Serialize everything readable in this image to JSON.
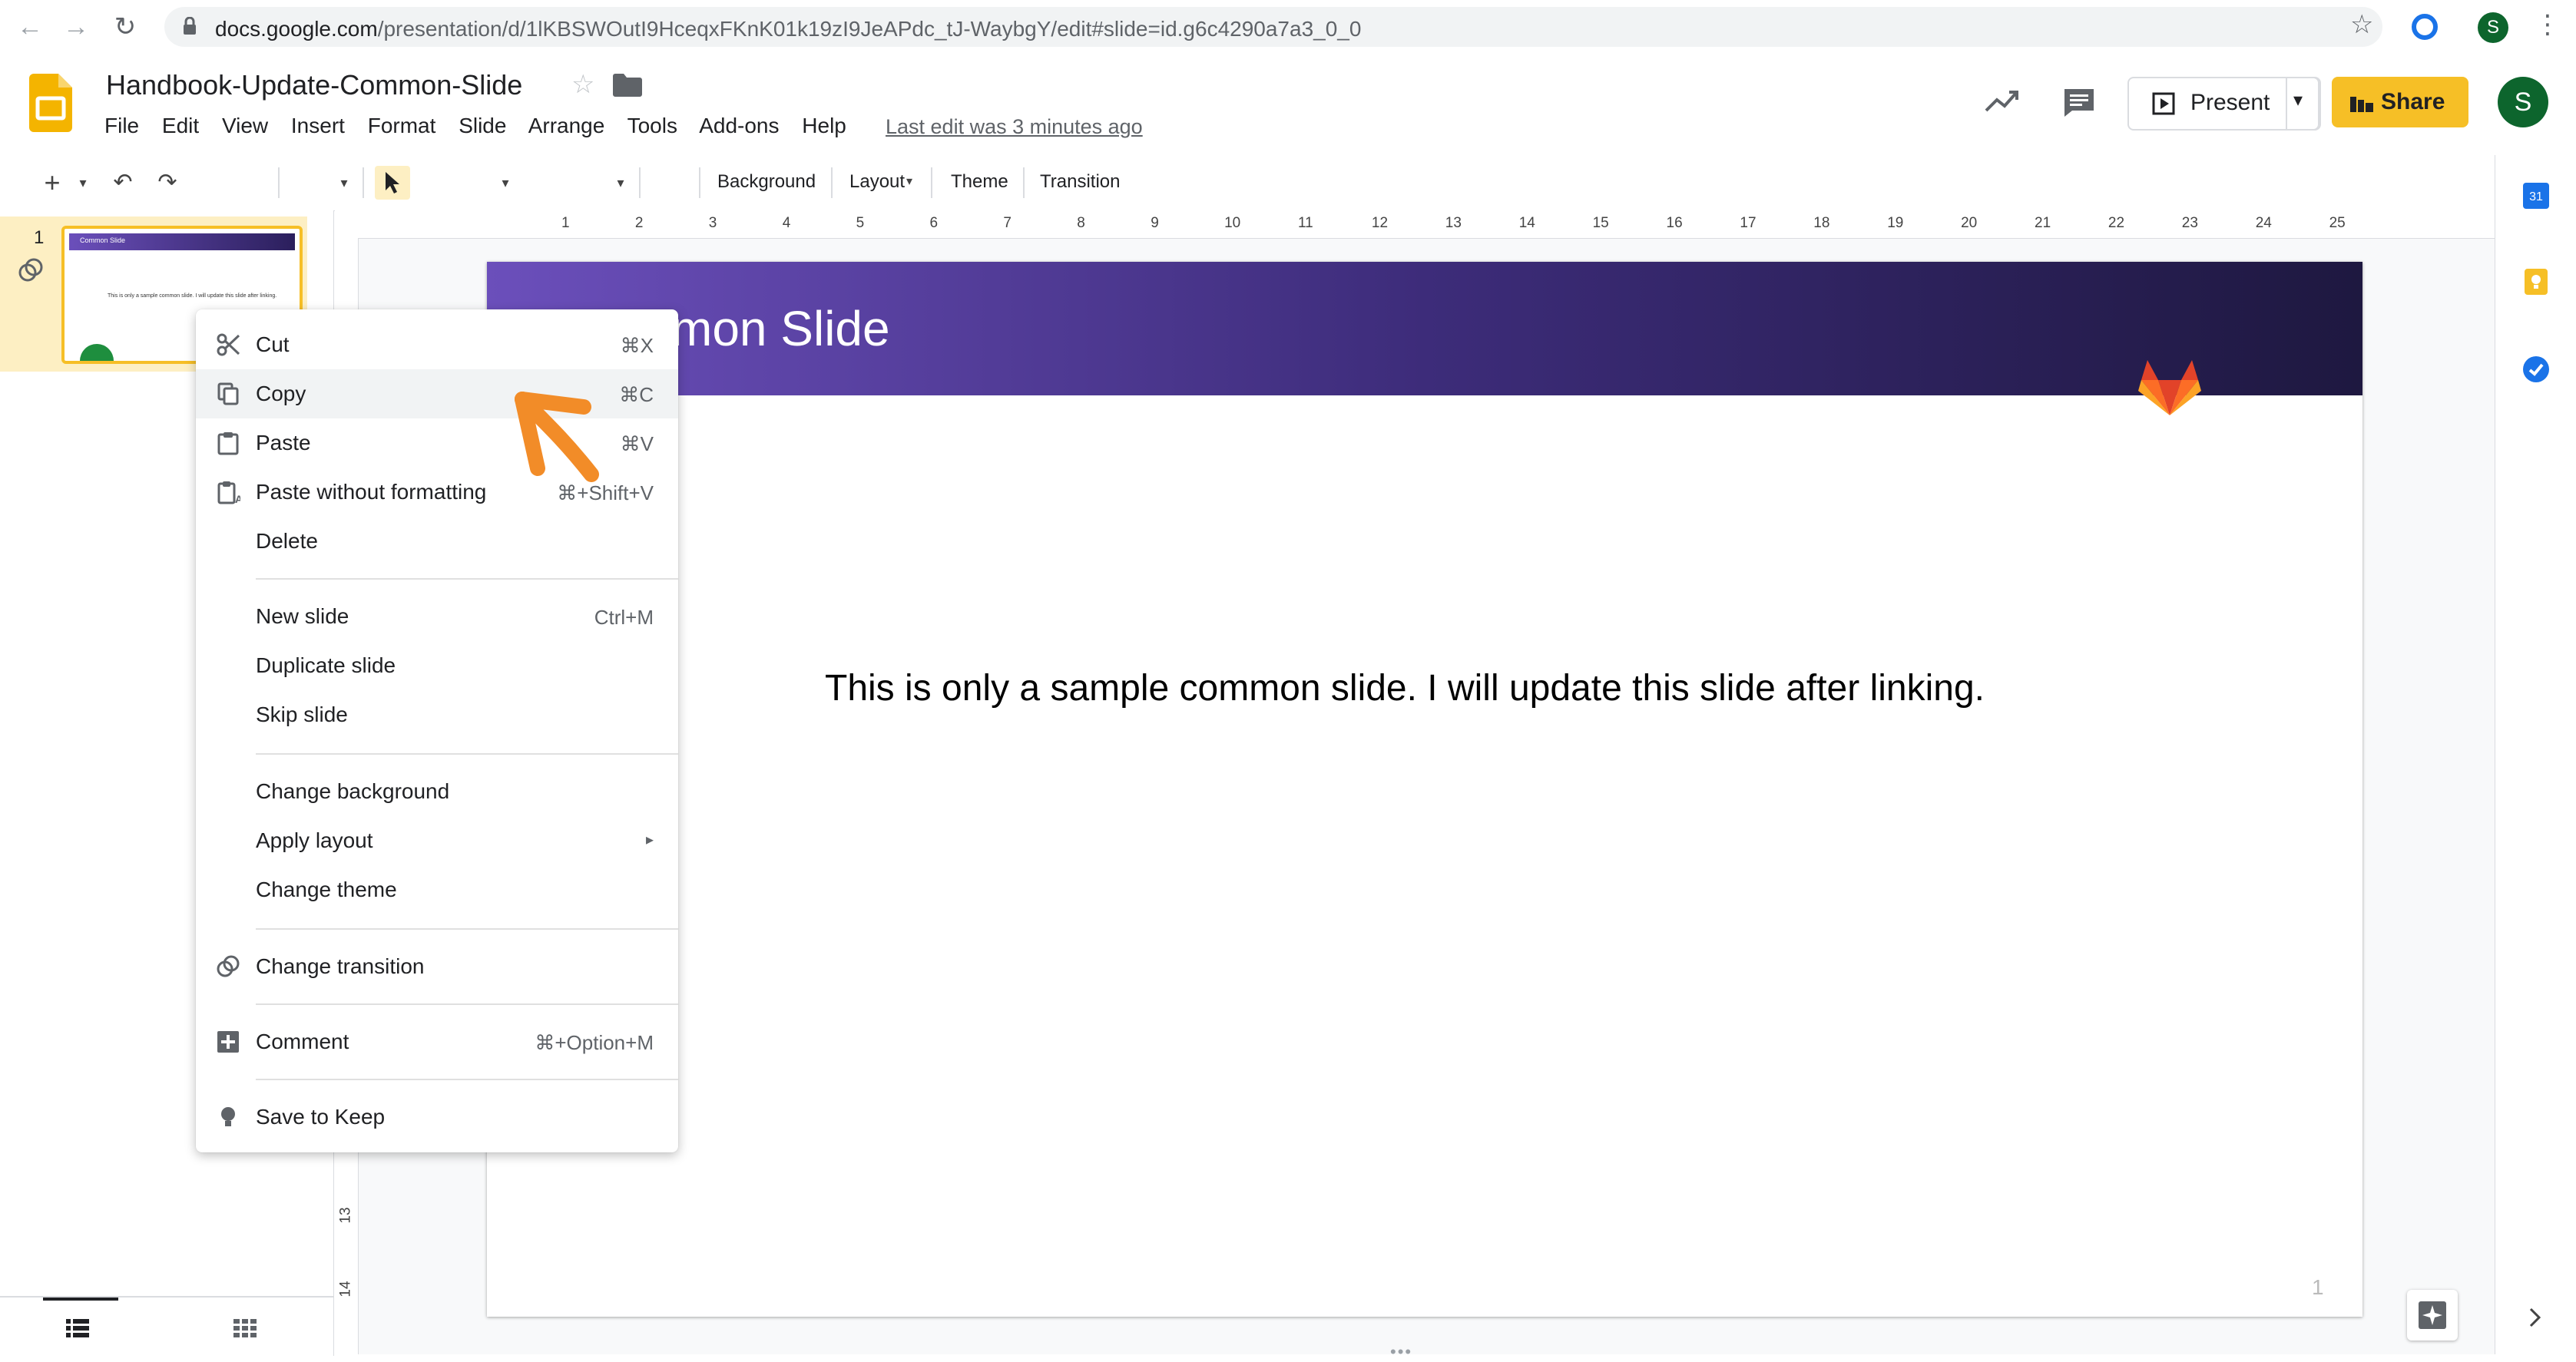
{
  "browser": {
    "url_host": "docs.google.com",
    "url_path": "/presentation/d/1lKBSWOutI9HceqxFKnK01k19zI9JeAPdc_tJ-WaybgY/edit#slide=id.g6c4290a7a3_0_0",
    "profile_initial": "S"
  },
  "doc": {
    "title": "Handbook-Update-Common-Slide",
    "menu": [
      "File",
      "Edit",
      "View",
      "Insert",
      "Format",
      "Slide",
      "Arrange",
      "Tools",
      "Add-ons",
      "Help"
    ],
    "last_edit": "Last edit was 3 minutes ago",
    "present_label": "Present",
    "share_label": "Share",
    "account_initial": "S"
  },
  "toolbar": {
    "background_label": "Background",
    "layout_label": "Layout",
    "theme_label": "Theme",
    "transition_label": "Transition"
  },
  "filmstrip": {
    "slide_number": "1",
    "thumb_title": "Common Slide",
    "thumb_body": "This is only a sample common slide. I will update this slide after linking."
  },
  "ruler": {
    "horizontal": [
      "1",
      "2",
      "3",
      "4",
      "5",
      "6",
      "7",
      "8",
      "9",
      "10",
      "11",
      "12",
      "13",
      "14",
      "15",
      "16",
      "17",
      "18",
      "19",
      "20",
      "21",
      "22",
      "23",
      "24",
      "25"
    ],
    "vertical": [
      "13",
      "14"
    ]
  },
  "slide": {
    "title_visible": "mon Slide",
    "body": "This is only a sample common slide. I will update this slide after linking.",
    "page_number": "1"
  },
  "context_menu": {
    "items": [
      {
        "label": "Cut",
        "shortcut": "⌘X",
        "icon": "scissors-icon"
      },
      {
        "label": "Copy",
        "shortcut": "⌘C",
        "icon": "copy-icon"
      },
      {
        "label": "Paste",
        "shortcut": "⌘V",
        "icon": "paste-icon"
      },
      {
        "label": "Paste without formatting",
        "shortcut": "⌘+Shift+V",
        "icon": "paste-plain-icon"
      },
      {
        "label": "Delete",
        "shortcut": "",
        "icon": ""
      },
      {
        "label": "New slide",
        "shortcut": "Ctrl+M",
        "icon": ""
      },
      {
        "label": "Duplicate slide",
        "shortcut": "",
        "icon": ""
      },
      {
        "label": "Skip slide",
        "shortcut": "",
        "icon": ""
      },
      {
        "label": "Change background",
        "shortcut": "",
        "icon": ""
      },
      {
        "label": "Apply layout",
        "shortcut": "▸",
        "icon": ""
      },
      {
        "label": "Change theme",
        "shortcut": "",
        "icon": ""
      },
      {
        "label": "Change transition",
        "shortcut": "",
        "icon": "transition-icon"
      },
      {
        "label": "Comment",
        "shortcut": "⌘+Option+M",
        "icon": "add-comment-icon"
      },
      {
        "label": "Save to Keep",
        "shortcut": "",
        "icon": "keep-bulb-icon"
      }
    ],
    "highlighted": "Copy"
  },
  "colors": {
    "accent_yellow": "#f6bf26",
    "slide_header_start": "#6b4fbb",
    "slide_header_end": "#1e1840",
    "annotation_arrow": "#f28c28"
  }
}
